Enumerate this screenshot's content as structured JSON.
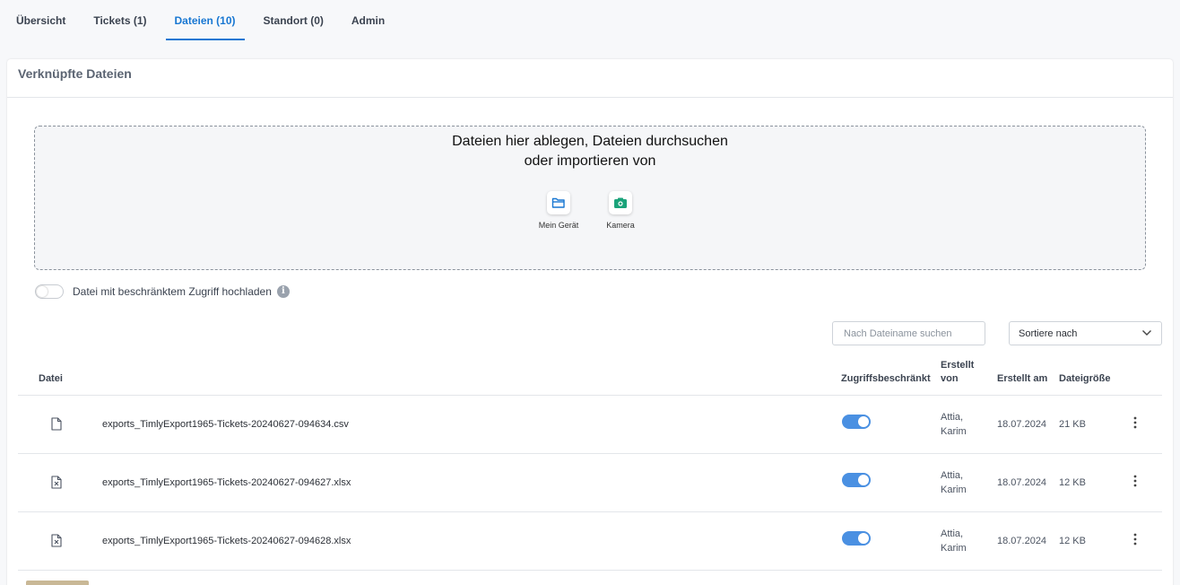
{
  "tabs": [
    {
      "label": "Übersicht",
      "active": false
    },
    {
      "label": "Tickets (1)",
      "active": false
    },
    {
      "label": "Dateien (10)",
      "active": true
    },
    {
      "label": "Standort (0)",
      "active": false
    },
    {
      "label": "Admin",
      "active": false
    }
  ],
  "card": {
    "title": "Verknüpfte Dateien"
  },
  "dropzone": {
    "line1": "Dateien hier ablegen, Dateien durchsuchen",
    "line2": "oder importieren von",
    "device_label": "Mein Gerät",
    "camera_label": "Kamera",
    "device_icon": "folder-icon",
    "camera_icon": "camera-icon"
  },
  "restricted": {
    "label": "Datei mit beschränktem Zugriff hochladen",
    "enabled": false
  },
  "search": {
    "placeholder": "Nach Dateiname suchen",
    "value": ""
  },
  "sort": {
    "label": "Sortiere nach"
  },
  "table": {
    "headers": {
      "file": "Datei",
      "restricted": "Zugriffsbeschränkt",
      "created_by_1": "Erstellt",
      "created_by_2": "von",
      "created_at": "Erstellt am",
      "size": "Dateigröße"
    },
    "rows": [
      {
        "icon": "file-icon",
        "name": "exports_TimlyExport1965-Tickets-20240627-094634.csv",
        "restricted": true,
        "author_last": "Attia,",
        "author_first": "Karim",
        "date": "18.07.2024",
        "size": "21 KB"
      },
      {
        "icon": "excel-file-icon",
        "name": "exports_TimlyExport1965-Tickets-20240627-094627.xlsx",
        "restricted": true,
        "author_last": "Attia,",
        "author_first": "Karim",
        "date": "18.07.2024",
        "size": "12 KB"
      },
      {
        "icon": "excel-file-icon",
        "name": "exports_TimlyExport1965-Tickets-20240627-094628.xlsx",
        "restricted": true,
        "author_last": "Attia,",
        "author_first": "Karim",
        "date": "18.07.2024",
        "size": "12 KB"
      }
    ]
  },
  "colors": {
    "accent": "#1877d2",
    "toggle_on": "#4a90e2",
    "camera_green": "#1aa37a"
  }
}
